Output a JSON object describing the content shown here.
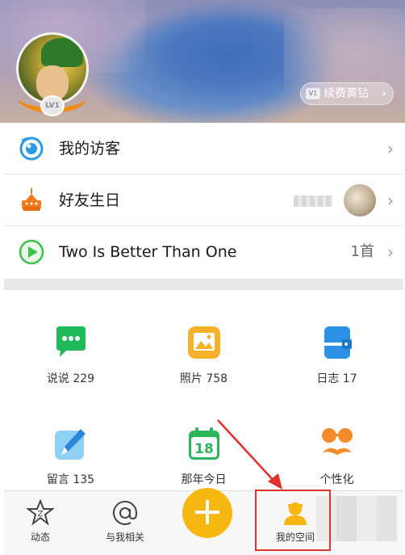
{
  "header": {
    "level_badge": "LV1",
    "renew_button": {
      "vip_tag": "V1",
      "label": "续费黄钻",
      "chevron": "›"
    }
  },
  "list": [
    {
      "icon": "eye-icon",
      "label": "我的访客",
      "right_text": "",
      "chevron": "›"
    },
    {
      "icon": "birthday-cake-icon",
      "label": "好友生日",
      "right_text": "",
      "chevron": "›"
    },
    {
      "icon": "play-icon",
      "label": "Two Is Better Than One",
      "right_text": "1首",
      "chevron": "›"
    }
  ],
  "grid": [
    {
      "icon": "chat-bubble-icon",
      "label": "说说 229",
      "color": "#1fbb5b"
    },
    {
      "icon": "photo-icon",
      "label": "照片 758",
      "color": "#f7b02a"
    },
    {
      "icon": "diary-icon",
      "label": "日志 17",
      "color": "#2c90e6"
    },
    {
      "icon": "pen-icon",
      "label": "留言 135",
      "color": "#3aa0ea"
    },
    {
      "icon": "calendar-icon",
      "label": "那年今日",
      "calendar_day": "18",
      "color": "#2cb55b"
    },
    {
      "icon": "mustache-icon",
      "label": "个性化",
      "color": "#f58a2a"
    }
  ],
  "tabbar": [
    {
      "icon": "star-z-icon",
      "label": "动态"
    },
    {
      "icon": "at-icon",
      "label": "与我相关"
    },
    {
      "icon": "plus-icon",
      "label": "+"
    },
    {
      "icon": "my-space-icon",
      "label": "我的空间"
    }
  ],
  "colors": {
    "accent": "#f7b711",
    "annotation": "#e0302a"
  }
}
